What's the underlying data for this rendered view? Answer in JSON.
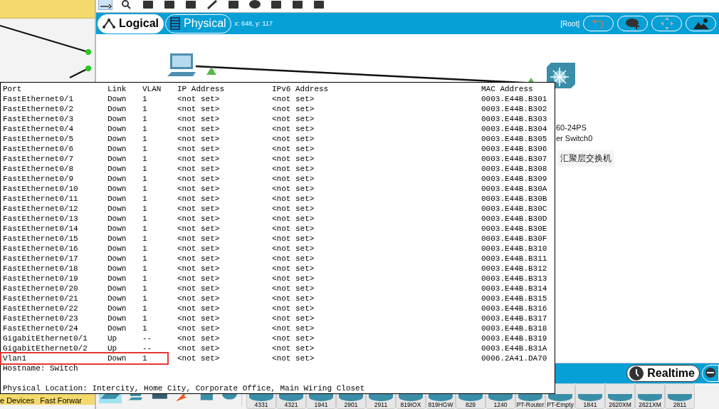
{
  "left_window": {
    "status_texts": [
      "e Devices",
      "Fast Forwar"
    ]
  },
  "view_bar": {
    "tabs": [
      {
        "label": "Logical",
        "selected": true
      },
      {
        "label": "Physical",
        "selected": false
      }
    ],
    "coordinates": "x: 648, y: 117",
    "path": "[Root]"
  },
  "canvas": {
    "devices": [
      {
        "kind": "pc"
      },
      {
        "kind": "switch",
        "labels": [
          "60-24PS",
          "er Switch0",
          "汇聚层交换机"
        ]
      }
    ]
  },
  "port_table": {
    "columns": [
      "Port",
      "Link",
      "VLAN",
      "IP Address",
      "IPv6 Address",
      "MAC Address"
    ],
    "rows": [
      {
        "cells": [
          "FastEthernet0/1",
          "Down",
          "1",
          "<not set>",
          "<not set>",
          "0003.E44B.B301"
        ],
        "highlighted": false
      },
      {
        "cells": [
          "FastEthernet0/2",
          "Down",
          "1",
          "<not set>",
          "<not set>",
          "0003.E44B.B302"
        ],
        "highlighted": false
      },
      {
        "cells": [
          "FastEthernet0/3",
          "Down",
          "1",
          "<not set>",
          "<not set>",
          "0003.E44B.B303"
        ],
        "highlighted": false
      },
      {
        "cells": [
          "FastEthernet0/4",
          "Down",
          "1",
          "<not set>",
          "<not set>",
          "0003.E44B.B304"
        ],
        "highlighted": false
      },
      {
        "cells": [
          "FastEthernet0/5",
          "Down",
          "1",
          "<not set>",
          "<not set>",
          "0003.E44B.B305"
        ],
        "highlighted": false
      },
      {
        "cells": [
          "FastEthernet0/6",
          "Down",
          "1",
          "<not set>",
          "<not set>",
          "0003.E44B.B306"
        ],
        "highlighted": false
      },
      {
        "cells": [
          "FastEthernet0/7",
          "Down",
          "1",
          "<not set>",
          "<not set>",
          "0003.E44B.B307"
        ],
        "highlighted": false
      },
      {
        "cells": [
          "FastEthernet0/8",
          "Down",
          "1",
          "<not set>",
          "<not set>",
          "0003.E44B.B308"
        ],
        "highlighted": false
      },
      {
        "cells": [
          "FastEthernet0/9",
          "Down",
          "1",
          "<not set>",
          "<not set>",
          "0003.E44B.B309"
        ],
        "highlighted": false
      },
      {
        "cells": [
          "FastEthernet0/10",
          "Down",
          "1",
          "<not set>",
          "<not set>",
          "0003.E44B.B30A"
        ],
        "highlighted": false
      },
      {
        "cells": [
          "FastEthernet0/11",
          "Down",
          "1",
          "<not set>",
          "<not set>",
          "0003.E44B.B30B"
        ],
        "highlighted": false
      },
      {
        "cells": [
          "FastEthernet0/12",
          "Down",
          "1",
          "<not set>",
          "<not set>",
          "0003.E44B.B30C"
        ],
        "highlighted": false
      },
      {
        "cells": [
          "FastEthernet0/13",
          "Down",
          "1",
          "<not set>",
          "<not set>",
          "0003.E44B.B30D"
        ],
        "highlighted": false
      },
      {
        "cells": [
          "FastEthernet0/14",
          "Down",
          "1",
          "<not set>",
          "<not set>",
          "0003.E44B.B30E"
        ],
        "highlighted": false
      },
      {
        "cells": [
          "FastEthernet0/15",
          "Down",
          "1",
          "<not set>",
          "<not set>",
          "0003.E44B.B30F"
        ],
        "highlighted": false
      },
      {
        "cells": [
          "FastEthernet0/16",
          "Down",
          "1",
          "<not set>",
          "<not set>",
          "0003.E44B.B310"
        ],
        "highlighted": false
      },
      {
        "cells": [
          "FastEthernet0/17",
          "Down",
          "1",
          "<not set>",
          "<not set>",
          "0003.E44B.B311"
        ],
        "highlighted": false
      },
      {
        "cells": [
          "FastEthernet0/18",
          "Down",
          "1",
          "<not set>",
          "<not set>",
          "0003.E44B.B312"
        ],
        "highlighted": false
      },
      {
        "cells": [
          "FastEthernet0/19",
          "Down",
          "1",
          "<not set>",
          "<not set>",
          "0003.E44B.B313"
        ],
        "highlighted": false
      },
      {
        "cells": [
          "FastEthernet0/20",
          "Down",
          "1",
          "<not set>",
          "<not set>",
          "0003.E44B.B314"
        ],
        "highlighted": false
      },
      {
        "cells": [
          "FastEthernet0/21",
          "Down",
          "1",
          "<not set>",
          "<not set>",
          "0003.E44B.B315"
        ],
        "highlighted": false
      },
      {
        "cells": [
          "FastEthernet0/22",
          "Down",
          "1",
          "<not set>",
          "<not set>",
          "0003.E44B.B316"
        ],
        "highlighted": false
      },
      {
        "cells": [
          "FastEthernet0/23",
          "Down",
          "1",
          "<not set>",
          "<not set>",
          "0003.E44B.B317"
        ],
        "highlighted": false
      },
      {
        "cells": [
          "FastEthernet0/24",
          "Down",
          "1",
          "<not set>",
          "<not set>",
          "0003.E44B.B318"
        ],
        "highlighted": false
      },
      {
        "cells": [
          "GigabitEthernet0/1",
          "Up",
          "--",
          "<not set>",
          "<not set>",
          "0003.E44B.B319"
        ],
        "highlighted": false
      },
      {
        "cells": [
          "GigabitEthernet0/2",
          "Up",
          "--",
          "<not set>",
          "<not set>",
          "0003.E44B.B31A"
        ],
        "highlighted": false
      },
      {
        "cells": [
          "Vlan1",
          "Down",
          "1",
          "<not set>",
          "<not set>",
          "0006.2A41.DA70"
        ],
        "highlighted": true
      }
    ],
    "hostname": "Hostname: Switch",
    "location": "Physical Location: Intercity, Home City, Corporate Office, Main Wiring Closet"
  },
  "mode_bar": {
    "realtime": "Realtime"
  },
  "device_palette": {
    "models": [
      "4331",
      "4321",
      "1941",
      "2901",
      "2911",
      "819IOX",
      "819HGW",
      "829",
      "1240",
      "PT-Router",
      "PT-Empty",
      "1841",
      "2620XM",
      "2621XM",
      "2811"
    ]
  }
}
